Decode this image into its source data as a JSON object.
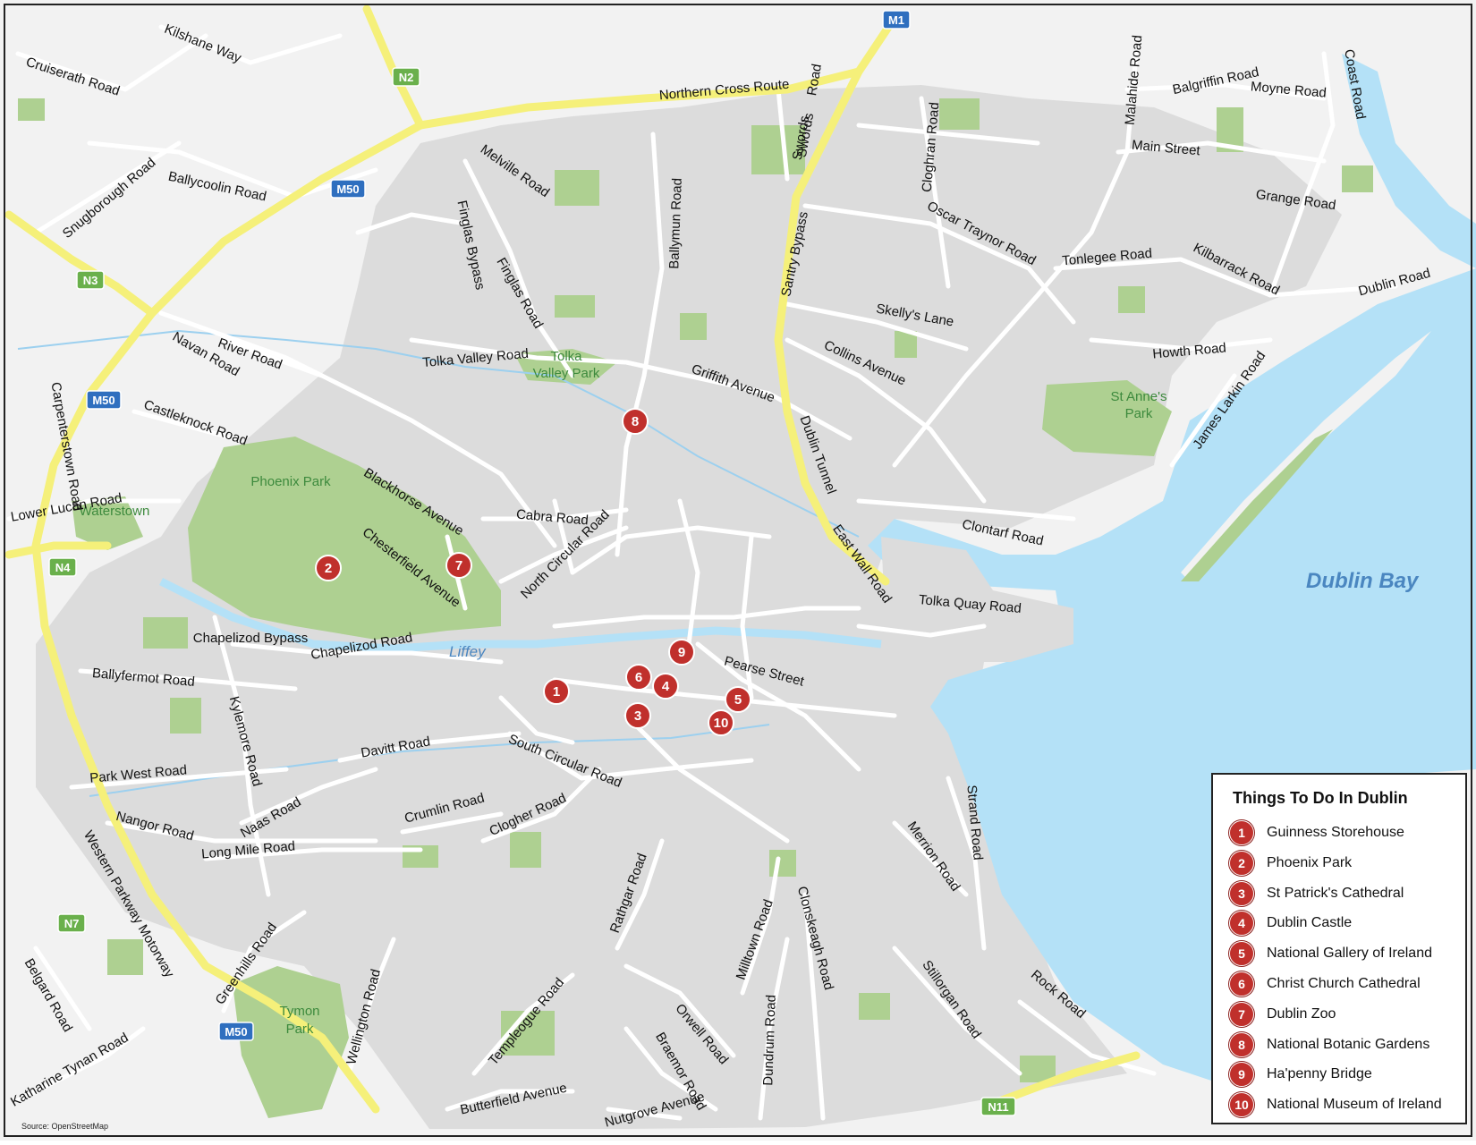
{
  "map": {
    "source": "Source: OpenStreetMap",
    "water_labels": {
      "bay": "Dublin Bay",
      "river": "Liffey"
    },
    "park_labels": [
      {
        "id": "phoenix",
        "text": "Phoenix Park"
      },
      {
        "id": "tolka1",
        "text": "Tolka"
      },
      {
        "id": "tolka2",
        "text": "Valley Park"
      },
      {
        "id": "waterstown",
        "text": "Waterstown"
      },
      {
        "id": "stanne1",
        "text": "St Anne's"
      },
      {
        "id": "stanne2",
        "text": "Park"
      },
      {
        "id": "tymon1",
        "text": "Tymon"
      },
      {
        "id": "tymon2",
        "text": "Park"
      }
    ],
    "shields": [
      {
        "id": "m1",
        "text": "M1",
        "type": "motorway"
      },
      {
        "id": "m50a",
        "text": "M50",
        "type": "motorway"
      },
      {
        "id": "m50b",
        "text": "M50",
        "type": "motorway"
      },
      {
        "id": "m50c",
        "text": "M50",
        "type": "motorway"
      },
      {
        "id": "n2",
        "text": "N2",
        "type": "national"
      },
      {
        "id": "n3",
        "text": "N3",
        "type": "national"
      },
      {
        "id": "n4",
        "text": "N4",
        "type": "national"
      },
      {
        "id": "n7",
        "text": "N7",
        "type": "national"
      },
      {
        "id": "n11",
        "text": "N11",
        "type": "national"
      }
    ],
    "road_labels": [
      {
        "id": "r1",
        "text": "Kilshane Way"
      },
      {
        "id": "r2",
        "text": "Cruiserath Road"
      },
      {
        "id": "r3",
        "text": "Northern Cross Route"
      },
      {
        "id": "r4",
        "text": "Swords"
      },
      {
        "id": "r5",
        "text": "Road"
      },
      {
        "id": "r6",
        "text": "Malahide Road"
      },
      {
        "id": "r7",
        "text": "Coast Road"
      },
      {
        "id": "r8",
        "text": "Balgriffin Road"
      },
      {
        "id": "r9",
        "text": "Moyne Road"
      },
      {
        "id": "r10",
        "text": "Main Street"
      },
      {
        "id": "r11",
        "text": "Grange Road"
      },
      {
        "id": "r12",
        "text": "Cloghran Road"
      },
      {
        "id": "r13",
        "text": "Oscar Traynor Road"
      },
      {
        "id": "r14",
        "text": "Tonlegee Road"
      },
      {
        "id": "r15",
        "text": "Kilbarrack Road"
      },
      {
        "id": "r16",
        "text": "Dublin Road"
      },
      {
        "id": "r17",
        "text": "Melville Road"
      },
      {
        "id": "r18",
        "text": "Ballymun Road"
      },
      {
        "id": "r19",
        "text": "Swords"
      },
      {
        "id": "r20",
        "text": "Santry Bypass"
      },
      {
        "id": "r21",
        "text": "Snugborough Road"
      },
      {
        "id": "r22",
        "text": "Ballycoolin Road"
      },
      {
        "id": "r23",
        "text": "Finglas Bypass"
      },
      {
        "id": "r24",
        "text": "Finglas Road"
      },
      {
        "id": "r25",
        "text": "Skelly's Lane"
      },
      {
        "id": "r26",
        "text": "Howth Road"
      },
      {
        "id": "r27",
        "text": "James Larkin Road"
      },
      {
        "id": "r28",
        "text": "Collins Avenue"
      },
      {
        "id": "r29",
        "text": "River Road"
      },
      {
        "id": "r30",
        "text": "Navan Road"
      },
      {
        "id": "r31",
        "text": "Tolka Valley Road"
      },
      {
        "id": "r32",
        "text": "Griffith Avenue"
      },
      {
        "id": "r33",
        "text": "Dublin Tunnel"
      },
      {
        "id": "r34",
        "text": "Carpenterstown Road"
      },
      {
        "id": "r35",
        "text": "Castleknock Road"
      },
      {
        "id": "r36",
        "text": "Blackhorse Avenue"
      },
      {
        "id": "r37",
        "text": "Lower Lucan Road"
      },
      {
        "id": "r38",
        "text": "Cabra Road"
      },
      {
        "id": "r39",
        "text": "North Circular Road"
      },
      {
        "id": "r40",
        "text": "Clontarf Road"
      },
      {
        "id": "r41",
        "text": "East Wall Road"
      },
      {
        "id": "r42",
        "text": "Chesterfield Avenue"
      },
      {
        "id": "r43",
        "text": "Tolka Quay Road"
      },
      {
        "id": "r44",
        "text": "Chapelizod Road"
      },
      {
        "id": "r45",
        "text": "Chapelizod Bypass"
      },
      {
        "id": "r46",
        "text": "Ballyfermot Road"
      },
      {
        "id": "r47",
        "text": "Pearse Street"
      },
      {
        "id": "r48",
        "text": "Kylemore Road"
      },
      {
        "id": "r49",
        "text": "Davitt Road"
      },
      {
        "id": "r50",
        "text": "South Circular Road"
      },
      {
        "id": "r51",
        "text": "Park West Road"
      },
      {
        "id": "r52",
        "text": "Naas Road"
      },
      {
        "id": "r53",
        "text": "Crumlin Road"
      },
      {
        "id": "r54",
        "text": "Clogher Road"
      },
      {
        "id": "r55",
        "text": "Nangor Road"
      },
      {
        "id": "r56",
        "text": "Long Mile Road"
      },
      {
        "id": "r57",
        "text": "Western Parkway Motorway"
      },
      {
        "id": "r58",
        "text": "Strand Road"
      },
      {
        "id": "r59",
        "text": "Merrion Road"
      },
      {
        "id": "r60",
        "text": "Rathgar Road"
      },
      {
        "id": "r61",
        "text": "Clonskeagh Road"
      },
      {
        "id": "r62",
        "text": "Milltown Road"
      },
      {
        "id": "r63",
        "text": "Greenhills Road"
      },
      {
        "id": "r64",
        "text": "Stillorgan Road"
      },
      {
        "id": "r65",
        "text": "Rock Road"
      },
      {
        "id": "r66",
        "text": "Belgard Road"
      },
      {
        "id": "r67",
        "text": "Wellington Road"
      },
      {
        "id": "r68",
        "text": "Templeogue Road"
      },
      {
        "id": "r69",
        "text": "Orwell Road"
      },
      {
        "id": "r70",
        "text": "Dundrum Road"
      },
      {
        "id": "r71",
        "text": "Katharine Tynan Road"
      },
      {
        "id": "r72",
        "text": "Braemor Road"
      },
      {
        "id": "r73",
        "text": "Butterfield Avenue"
      },
      {
        "id": "r74",
        "text": "Nutgrove Avenue"
      }
    ],
    "markers": [
      {
        "id": "m-1",
        "text": "1"
      },
      {
        "id": "m-2",
        "text": "2"
      },
      {
        "id": "m-3",
        "text": "3"
      },
      {
        "id": "m-4",
        "text": "4"
      },
      {
        "id": "m-5",
        "text": "5"
      },
      {
        "id": "m-6",
        "text": "6"
      },
      {
        "id": "m-7",
        "text": "7"
      },
      {
        "id": "m-8",
        "text": "8"
      },
      {
        "id": "m-9",
        "text": "9"
      },
      {
        "id": "m-10",
        "text": "10"
      }
    ]
  },
  "legend": {
    "title": "Things To Do In Dublin",
    "items": [
      {
        "num": "1",
        "label": "Guinness Storehouse"
      },
      {
        "num": "2",
        "label": "Phoenix Park"
      },
      {
        "num": "3",
        "label": "St Patrick's Cathedral"
      },
      {
        "num": "4",
        "label": "Dublin Castle"
      },
      {
        "num": "5",
        "label": "National Gallery of Ireland"
      },
      {
        "num": "6",
        "label": "Christ Church Cathedral"
      },
      {
        "num": "7",
        "label": "Dublin Zoo"
      },
      {
        "num": "8",
        "label": "National Botanic Gardens"
      },
      {
        "num": "9",
        "label": "Ha'penny Bridge"
      },
      {
        "num": "10",
        "label": "National Museum of Ireland"
      }
    ],
    "marker_color": "#c0302c"
  },
  "colors": {
    "land": "#f2f2f2",
    "urban": "#dcdcdc",
    "park": "#aed091",
    "water": "#b4e1f7",
    "motorway": "#f5f07a",
    "motorway_shield": "#2f6fbf",
    "national_shield": "#6ab04c"
  }
}
